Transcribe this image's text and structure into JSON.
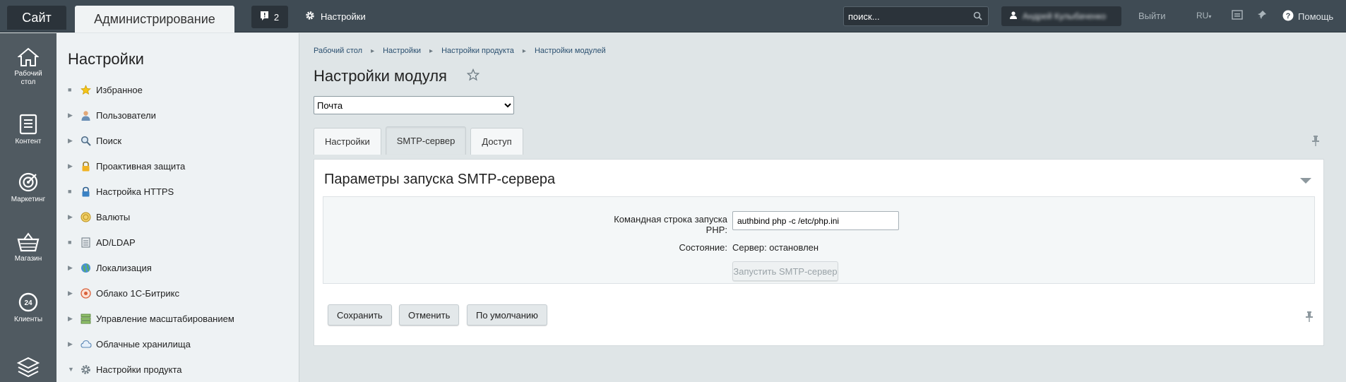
{
  "topbar": {
    "site_tab": "Сайт",
    "admin_tab": "Администрирование",
    "notifications_count": "2",
    "settings_link": "Настройки",
    "search_placeholder": "поиск...",
    "user_name": "Андрей Кулыбаченко",
    "logout": "Выйти",
    "language": "RU",
    "help": "Помощь"
  },
  "leftbar": {
    "items": [
      {
        "label": "Рабочий стол",
        "icon": "home-icon"
      },
      {
        "label": "Контент",
        "icon": "document-icon"
      },
      {
        "label": "Маркетинг",
        "icon": "target-icon"
      },
      {
        "label": "Магазин",
        "icon": "basket-icon"
      },
      {
        "label": "Клиенты",
        "icon": "clock-24-icon"
      },
      {
        "label": "",
        "icon": "layers-icon"
      }
    ]
  },
  "menu": {
    "title": "Настройки",
    "items": [
      {
        "label": "Избранное",
        "arrow": "none",
        "icon": "star-icon"
      },
      {
        "label": "Пользователи",
        "arrow": "right",
        "icon": "user-icon"
      },
      {
        "label": "Поиск",
        "arrow": "right",
        "icon": "magnifier-icon"
      },
      {
        "label": "Проактивная защита",
        "arrow": "right",
        "icon": "lock-icon"
      },
      {
        "label": "Настройка HTTPS",
        "arrow": "none",
        "icon": "https-lock-icon"
      },
      {
        "label": "Валюты",
        "arrow": "right",
        "icon": "coin-icon"
      },
      {
        "label": "AD/LDAP",
        "arrow": "none",
        "icon": "server-icon"
      },
      {
        "label": "Локализация",
        "arrow": "right",
        "icon": "globe-icon"
      },
      {
        "label": "Облако 1С-Битрикс",
        "arrow": "right",
        "icon": "cloud-bitrix-icon"
      },
      {
        "label": "Управление масштабированием",
        "arrow": "right",
        "icon": "scale-icon"
      },
      {
        "label": "Облачные хранилища",
        "arrow": "right",
        "icon": "cloud-icon"
      },
      {
        "label": "Настройки продукта",
        "arrow": "down",
        "icon": "gear-icon"
      }
    ]
  },
  "breadcrumb": [
    "Рабочий стол",
    "Настройки",
    "Настройки продукта",
    "Настройки модулей"
  ],
  "page": {
    "title": "Настройки модуля",
    "module_select": "Почта",
    "tabs": [
      "Настройки",
      "SMTP-сервер",
      "Доступ"
    ],
    "active_tab": "SMTP-сервер"
  },
  "panel": {
    "title": "Параметры запуска SMTP-сервера",
    "php_label": "Командная строка запуска PHP:",
    "php_value": "authbind php -c /etc/php.ini",
    "state_label": "Состояние:",
    "state_value": "Сервер: остановлен",
    "start_button": "Запустить SMTP-сервер"
  },
  "buttons": {
    "save": "Сохранить",
    "cancel": "Отменить",
    "default": "По умолчанию"
  },
  "colors": {
    "topbar": "#3f4b54",
    "leftbar": "#505a61",
    "background": "#dfe5e7"
  }
}
